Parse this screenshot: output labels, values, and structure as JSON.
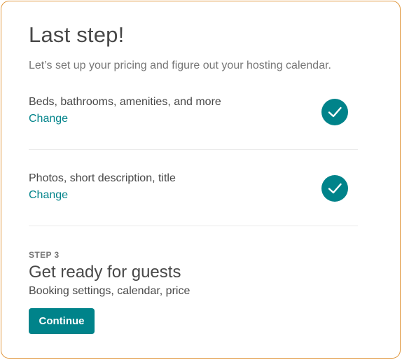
{
  "header": {
    "title": "Last step!",
    "subtitle": "Let’s set up your pricing and figure out your hosting calendar."
  },
  "steps": [
    {
      "label": "Beds, bathrooms, amenities, and more",
      "action": "Change",
      "status": "complete",
      "status_icon": "checkmark-icon"
    },
    {
      "label": "Photos, short description, title",
      "action": "Change",
      "status": "complete",
      "status_icon": "checkmark-icon"
    }
  ],
  "current_step": {
    "kicker": "STEP 3",
    "heading": "Get ready for guests",
    "description": "Booking settings, calendar, price",
    "button_label": "Continue"
  },
  "colors": {
    "accent": "#00838a",
    "card_border": "#e0973d",
    "text": "#484848",
    "muted_text": "#767676"
  }
}
